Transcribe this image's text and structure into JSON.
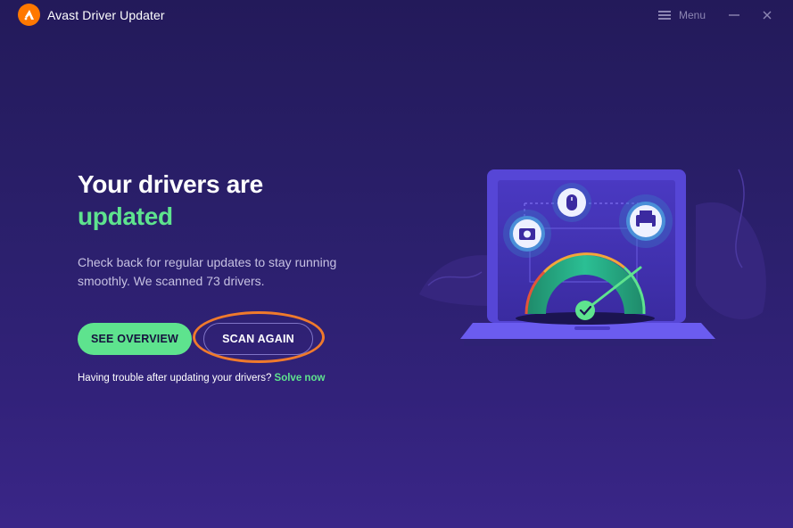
{
  "window": {
    "title": "Avast Driver Updater",
    "menu_label": "Menu"
  },
  "main": {
    "headline_line1": "Your drivers are",
    "headline_line2": "updated",
    "description": "Check back for regular updates to stay running smoothly. We scanned 73 drivers.",
    "see_overview_label": "SEE OVERVIEW",
    "scan_again_label": "SCAN AGAIN",
    "help_text": "Having trouble after updating your drivers?",
    "help_link": "Solve now"
  },
  "icons": [
    "avast-logo-icon",
    "menu-icon",
    "minimize-icon",
    "close-icon",
    "camera-icon",
    "mouse-icon",
    "printer-icon",
    "check-icon"
  ],
  "colors": {
    "accent_green": "#5ee38e",
    "brand_orange": "#ff7800",
    "highlight_orange": "#f07a2c",
    "background": "#2a1f6a"
  }
}
